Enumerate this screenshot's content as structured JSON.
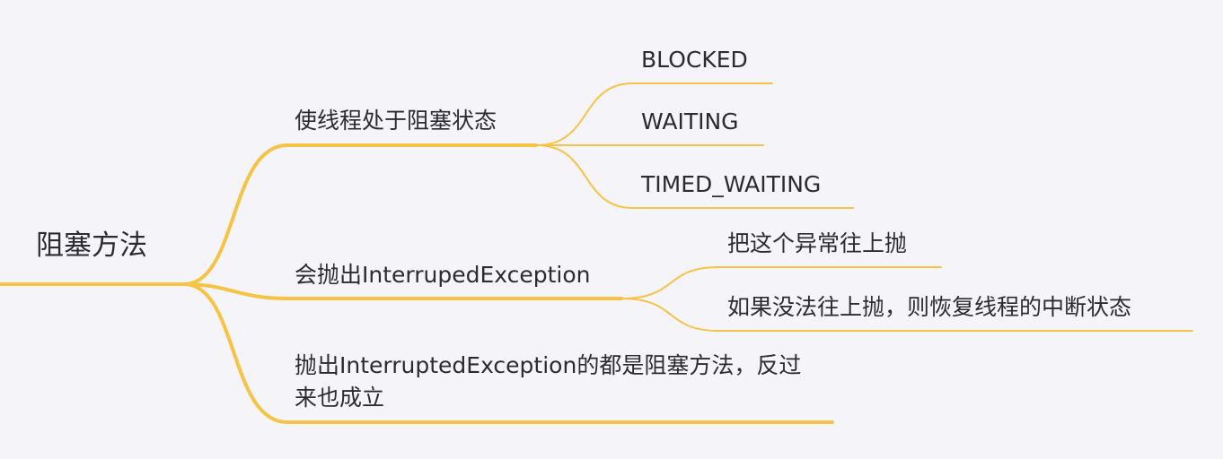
{
  "theme": {
    "branch_color": "#f6c344",
    "text_color": "#2b2b33",
    "background": "#f5f5f9"
  },
  "mindmap": {
    "root": "阻塞方法",
    "branches": [
      {
        "label": "使线程处于阻塞状态",
        "children": [
          "BLOCKED",
          "WAITING",
          "TIMED_WAITING"
        ]
      },
      {
        "label": "会抛出InterrupedException",
        "children": [
          "把这个异常往上抛",
          "如果没法往上抛，则恢复线程的中断状态"
        ]
      },
      {
        "label": "抛出InterruptedException的都是阻塞方法，反过来也成立",
        "children": []
      }
    ]
  }
}
